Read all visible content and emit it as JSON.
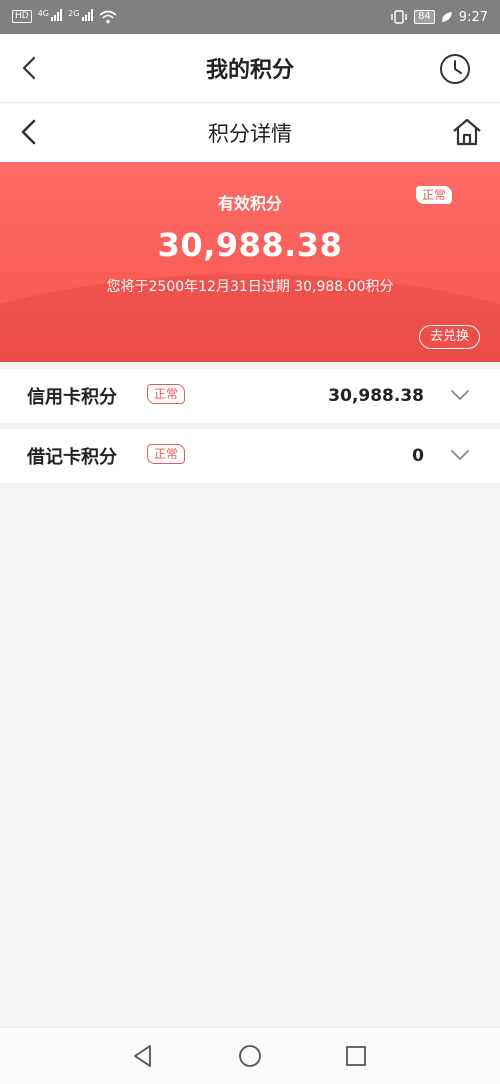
{
  "status_bar": {
    "hd_label": "HD",
    "net_1": "4G",
    "net_2": "2G",
    "battery": "84",
    "time": "9:27"
  },
  "nav_primary": {
    "title": "我的积分"
  },
  "nav_secondary": {
    "title": "积分详情"
  },
  "points_summary": {
    "label": "有效积分",
    "status": "正常",
    "amount": "30,988.38",
    "expiry_note": "您将于2500年12月31日过期 30,988.00积分",
    "redeem_label": "去兑换"
  },
  "accounts": [
    {
      "name": "信用卡积分",
      "status": "正常",
      "value": "30,988.38"
    },
    {
      "name": "借记卡积分",
      "status": "正常",
      "value": "0"
    }
  ],
  "colors": {
    "accent": "#f5544f",
    "status_tag": "#e85a55"
  },
  "icons": {
    "back": "chevron-left-icon",
    "history": "clock-icon",
    "home": "home-icon",
    "expand": "chevron-down-icon"
  }
}
